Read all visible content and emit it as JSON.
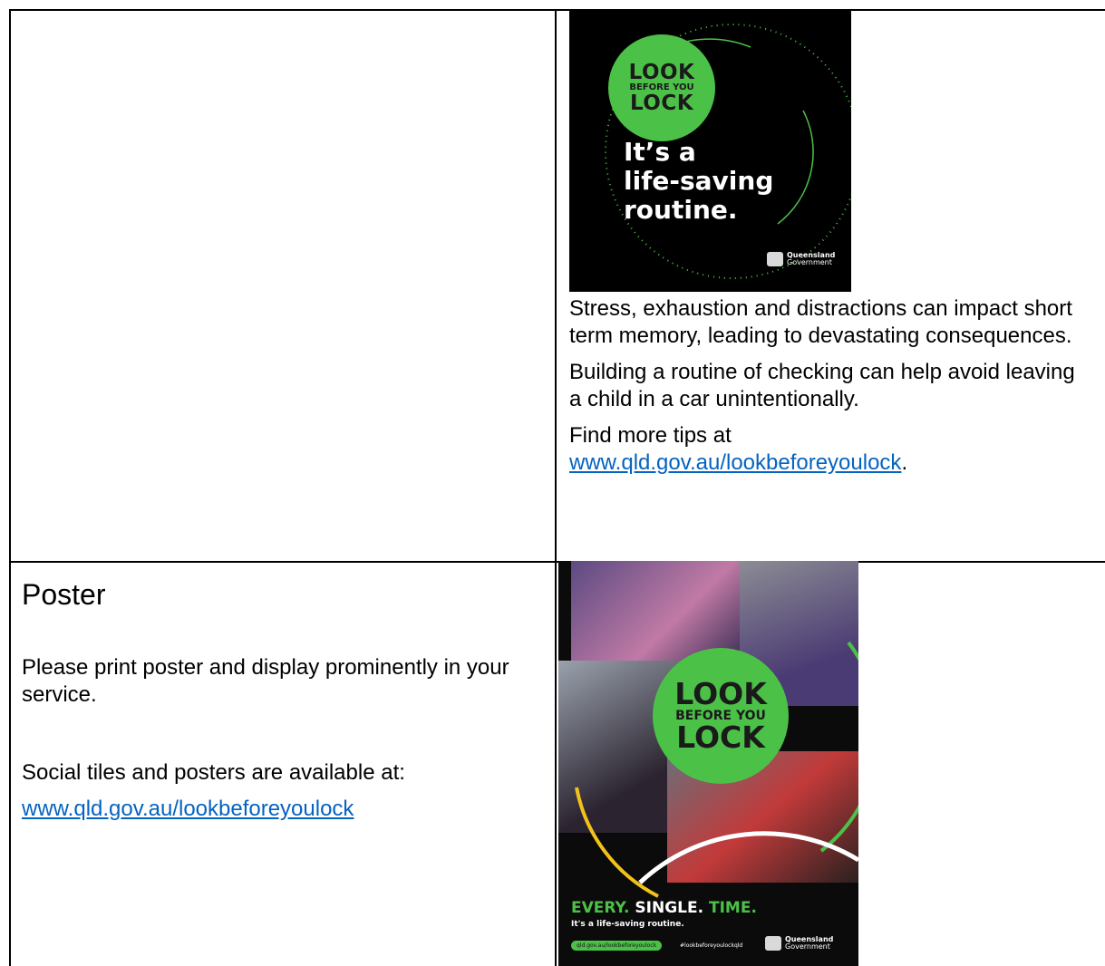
{
  "tile": {
    "badge_look": "LOOK",
    "badge_before": "BEFORE YOU",
    "badge_lock": "LOCK",
    "headline_1": "It’s a",
    "headline_2": "life-saving",
    "headline_3": "routine.",
    "gov_1": "Queensland",
    "gov_2": "Government"
  },
  "tile_text": {
    "p1": "Stress, exhaustion and distractions can impact short term memory, leading to devastating consequences.",
    "p2": "Building a routine of checking can help avoid leaving a child in a car unintentionally.",
    "p3_prefix": "Find more tips at",
    "p3_link": "www.qld.gov.au/lookbeforeyoulock",
    "p3_suffix": "."
  },
  "poster_section": {
    "heading": "Poster",
    "p1": "Please print poster and display prominently in your service.",
    "p2": "Social tiles and posters are available at:",
    "link": "www.qld.gov.au/lookbeforeyoulock"
  },
  "poster": {
    "badge_look": "LOOK",
    "badge_before": "BEFORE YOU",
    "badge_lock": "LOCK",
    "tag_every": "EVERY.",
    "tag_single": "SINGLE.",
    "tag_time": "TIME.",
    "sub": "It's a life-saving routine.",
    "pill": "qld.gov.au/lookbeforeyoulock",
    "hash": "#lookbeforeyoulockqld",
    "gov_1": "Queensland",
    "gov_2": "Government"
  },
  "colors": {
    "accent_green": "#4cc148",
    "link": "#0563c1",
    "accent_yellow": "#f2c21b"
  }
}
